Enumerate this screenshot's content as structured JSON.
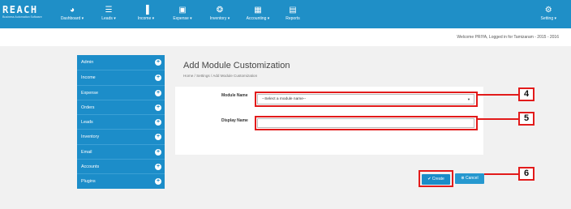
{
  "brand": {
    "name": "REACH",
    "tagline": "Business Automation Software"
  },
  "nav": [
    {
      "label": "Dashboard ▾",
      "icon": "dashboard-icon",
      "glyph": "◕"
    },
    {
      "label": "Leads ▾",
      "icon": "leads-icon",
      "glyph": "☰"
    },
    {
      "label": "Income ▾",
      "icon": "income-icon",
      "glyph": "▐"
    },
    {
      "label": "Expense ▾",
      "icon": "expense-icon",
      "glyph": "▣"
    },
    {
      "label": "Inventory ▾",
      "icon": "inventory-icon",
      "glyph": "❂"
    },
    {
      "label": "Accounting ▾",
      "icon": "accounting-icon",
      "glyph": "▦"
    },
    {
      "label": "Reports",
      "icon": "reports-icon",
      "glyph": "▤"
    }
  ],
  "setting": {
    "label": "Setting ▾",
    "icon": "gear-icon",
    "glyph": "⚙"
  },
  "welcome": "Welcome PRIYA, Logged in for Tamizaram - 2015 - 2016",
  "sidebar": {
    "items": [
      {
        "label": "Admin"
      },
      {
        "label": "Income"
      },
      {
        "label": "Expense"
      },
      {
        "label": "Orders"
      },
      {
        "label": "Leads"
      },
      {
        "label": "Inventory"
      },
      {
        "label": "Email"
      },
      {
        "label": "Accounts"
      },
      {
        "label": "Plugins"
      }
    ],
    "plus_glyph": "+"
  },
  "page": {
    "title": "Add Module Customization",
    "breadcrumb": "Home  /  Settings  /  Add Module Customization"
  },
  "form": {
    "module_name_label": "Module Name",
    "module_name_value": "--Select a module name--",
    "display_name_label": "Display Name",
    "display_name_value": ""
  },
  "buttons": {
    "create": "✔ Create",
    "cancel": "⊗ Cancel"
  },
  "callouts": [
    "4",
    "5",
    "6"
  ],
  "colors": {
    "header": "#1f8fc7",
    "sidebar": "#1c8dc9",
    "annotation": "#e21b1b",
    "background": "#f1f1f1"
  }
}
